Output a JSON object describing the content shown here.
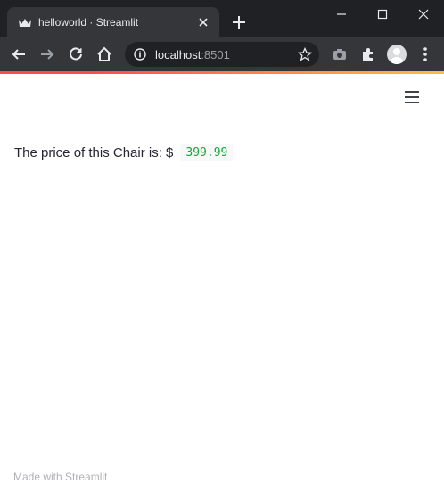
{
  "browser": {
    "tab": {
      "title": "helloworld · Streamlit",
      "favicon": "streamlit-crown-icon"
    },
    "address": {
      "host": "localhost",
      "port": ":8501"
    },
    "colors": {
      "chrome_dark": "#202124",
      "chrome_toolbar": "#35363a",
      "text": "#e8eaed",
      "muted": "#9aa0a6"
    }
  },
  "app": {
    "menu_icon": "hamburger-menu-icon",
    "price_label": "The price of this Chair is: $",
    "price_value": "399.99",
    "footer": "Made with Streamlit",
    "colors": {
      "accent_start": "#ff4b4b",
      "accent_end": "#ffbd45",
      "price_text": "#09ab3b",
      "body_text": "#262730"
    }
  }
}
